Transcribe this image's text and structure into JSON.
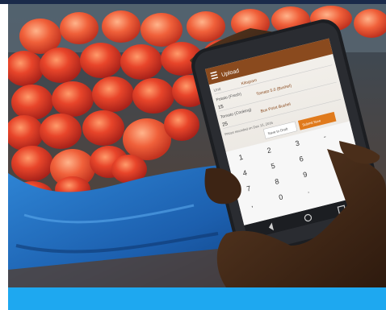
{
  "photo": {
    "description_icon": "market-tomatoes-phone-photo"
  },
  "app": {
    "header_title": "Upload",
    "menu_icon": "hamburger-icon",
    "unit_label": "Unit",
    "unit_value": "Kilogram",
    "row1_label": "Potato (Fresh)",
    "row1_value": "15",
    "row1_unit": "Tomato 5.0 (Bushel)",
    "row2_label": "Tomato (Cooking)",
    "row2_value": "25",
    "row2_unit": "Bus Point Bushel",
    "prices_note": "Prices recorded on Dec 15, 2016",
    "save_button": "Save to Draft",
    "submit_button": "Submit Now"
  },
  "keypad": {
    "keys": [
      "1",
      "2",
      "3",
      "-",
      "4",
      "5",
      "6",
      "",
      "7",
      "8",
      "9",
      "",
      ",",
      "0",
      ".",
      ""
    ]
  },
  "colors": {
    "app_brand": "#8a4a1e",
    "accent_orange": "#e07a1c",
    "tarp_blue": "#1f6fbf",
    "footer_blue": "#1ea8f0",
    "confirm_green": "#2aa84a"
  }
}
